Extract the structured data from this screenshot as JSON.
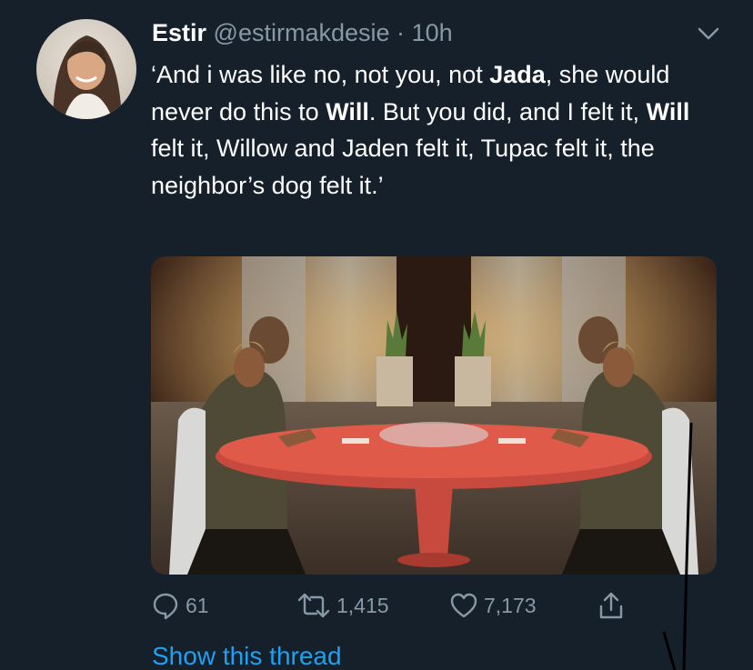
{
  "tweet": {
    "display_name": "Estir",
    "handle": "@estirmakdesie",
    "separator": "·",
    "time": "10h",
    "text_segments": [
      "‘And i was like no, not you, not ",
      "Jada",
      ", she would never do this to ",
      "Will",
      ". But you did, and I felt it, ",
      "Will",
      " felt it, Willow and Jaden felt it, Tupac felt it, the neighbor’s dog felt it.’"
    ],
    "media": {
      "icon": "video-still-image"
    },
    "actions": {
      "replies": "61",
      "retweets": "1,415",
      "likes": "7,173"
    },
    "show_thread_label": "Show this thread"
  },
  "colors": {
    "background": "#15202b",
    "secondary_text": "#8899a6",
    "link": "#1da1f2"
  }
}
